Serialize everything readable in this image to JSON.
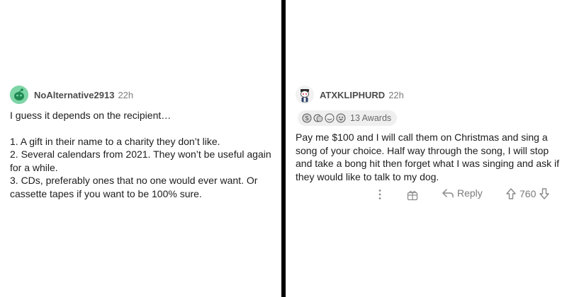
{
  "left_comment": {
    "username": "NoAlternative2913",
    "timestamp": "22h",
    "avatar_color": "#7ed5a6",
    "lines": [
      "I guess it depends on the recipient…",
      "",
      "1. A gift in their name to a charity they don’t like.",
      "2. Several calendars from 2021. They won’t be useful again for a while.",
      "3. CDs, preferably ones that no one would ever want. Or cassette tapes if you want to be 100% sure."
    ]
  },
  "right_comment": {
    "username": "ATXKLIPHURD",
    "timestamp": "22h",
    "awards": {
      "icons": [
        "silver-award-icon",
        "wholesome-award-icon",
        "helpful-award-icon",
        "laughing-award-icon"
      ],
      "label": "13 Awards"
    },
    "body": "Pay me $100 and I will call them on Christmas and sing a song of your choice. Half way through the song, I will stop and take a bong hit then forget what I was singing and ask if they would like to talk to my dog.",
    "actions": {
      "more_icon": "more-vertical-icon",
      "award_icon": "gift-award-icon",
      "reply_icon": "reply-arrow-icon",
      "reply_label": "Reply",
      "upvote_icon": "upvote-arrow-icon",
      "vote_count": "760",
      "downvote_icon": "downvote-arrow-icon"
    }
  },
  "colors": {
    "divider": "#000000",
    "award_pill_bg": "#efefef",
    "meta_text": "#7c7c7c"
  }
}
